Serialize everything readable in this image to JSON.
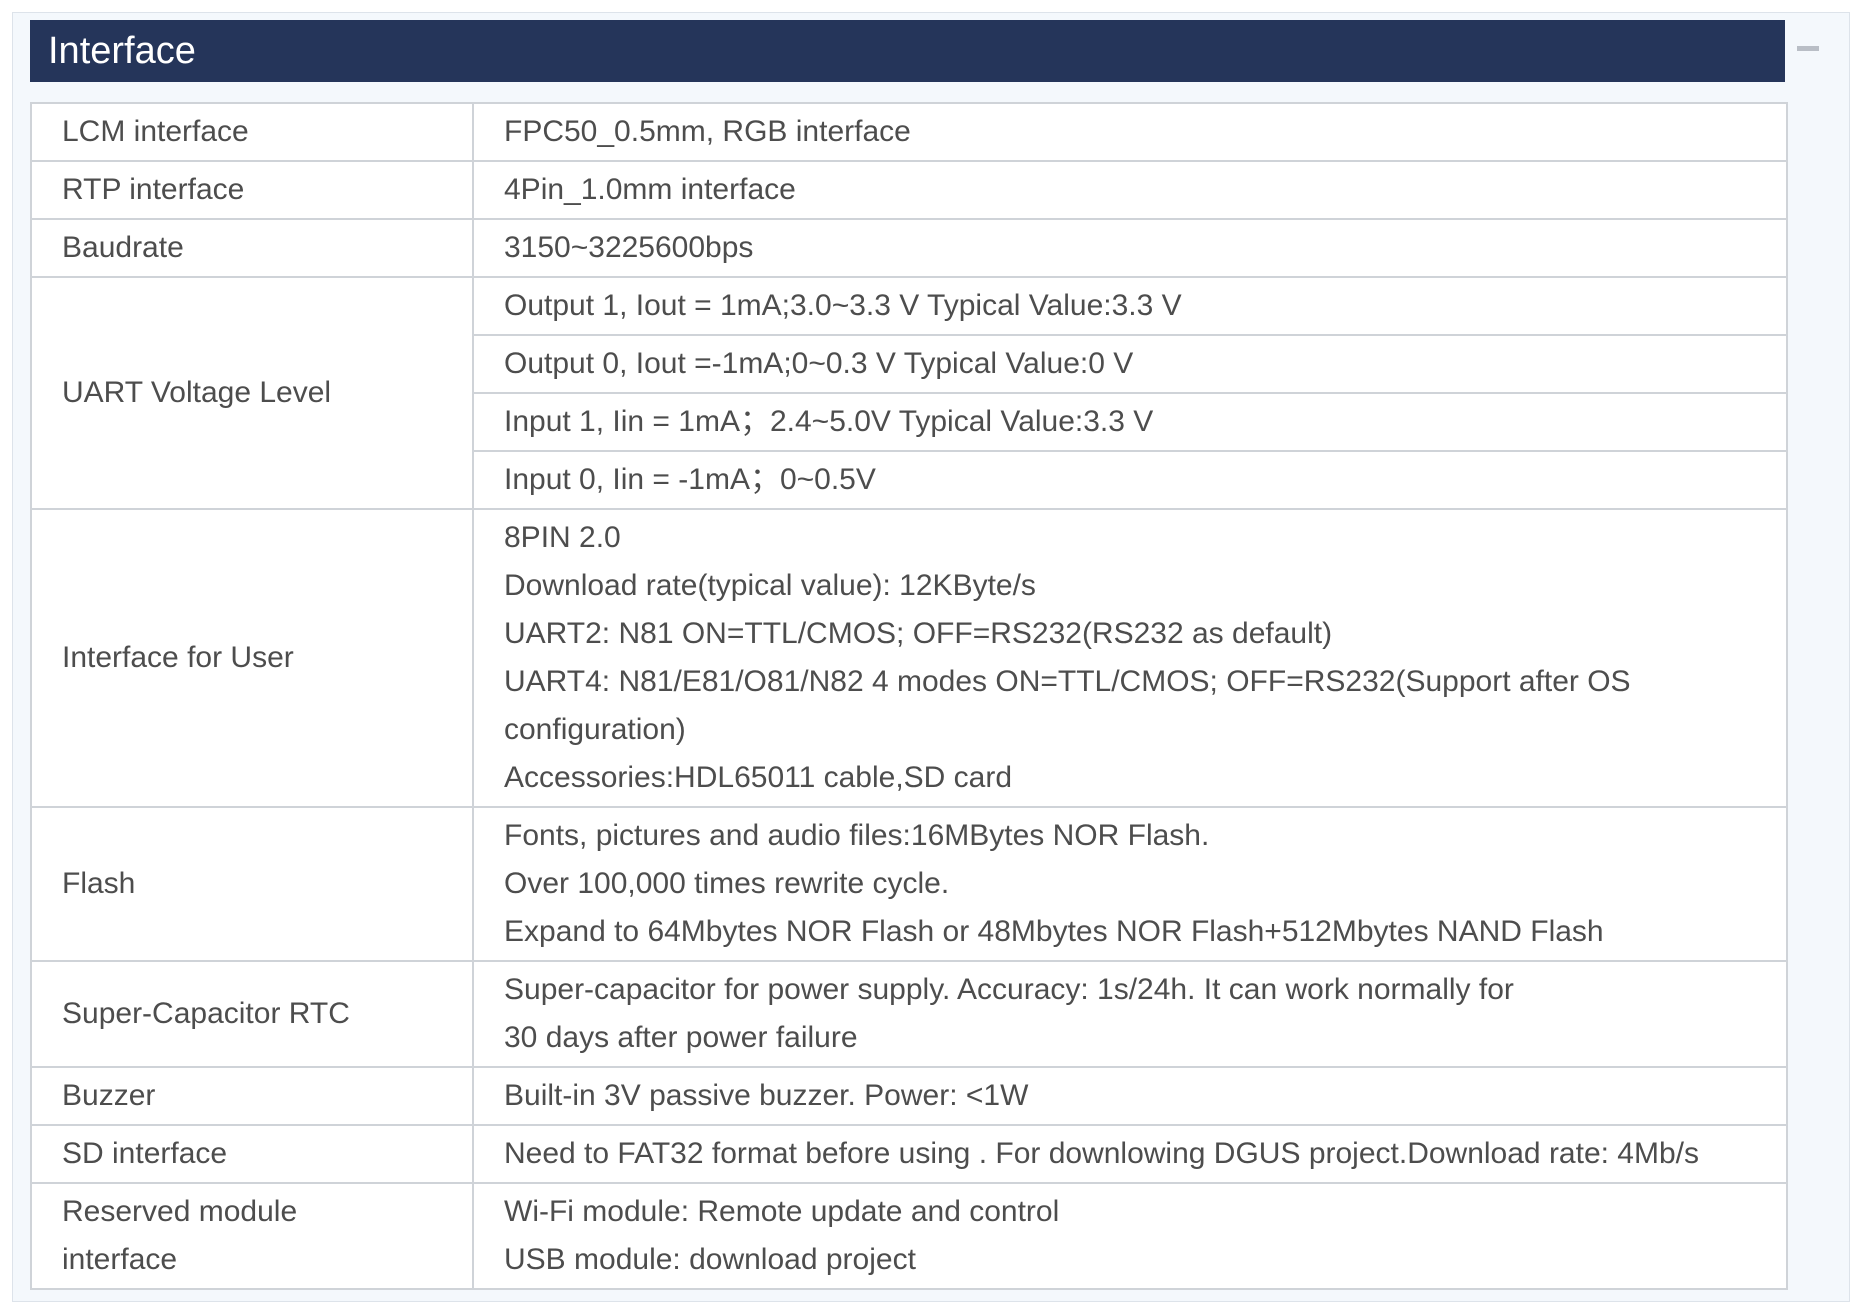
{
  "section": {
    "title": "Interface",
    "collapse_icon": "minus-icon"
  },
  "rows": {
    "lcm": {
      "label": "LCM interface",
      "value": "FPC50_0.5mm, RGB interface"
    },
    "rtp": {
      "label": "RTP interface",
      "value": "4Pin_1.0mm interface"
    },
    "baudrate": {
      "label": "Baudrate",
      "value": "3150~3225600bps"
    },
    "uart_voltage": {
      "label": "UART Voltage Level",
      "lines": [
        "Output 1, Iout = 1mA;3.0~3.3 V Typical Value:3.3 V",
        "Output 0, Iout =-1mA;0~0.3 V   Typical Value:0 V",
        "Input 1,    Iin = 1mA；2.4~5.0V Typical Value:3.3 V",
        "Input 0,    Iin = -1mA；0~0.5V"
      ]
    },
    "user_interface": {
      "label": "Interface for User",
      "lines": [
        "8PIN 2.0",
        "Download rate(typical value): 12KByte/s",
        "UART2: N81  ON=TTL/CMOS; OFF=RS232(RS232 as default)",
        "UART4: N81/E81/O81/N82 4 modes ON=TTL/CMOS; OFF=RS232(Support after OS configuration)",
        "Accessories:HDL65011 cable,SD card"
      ]
    },
    "flash": {
      "label": "Flash",
      "lines": [
        "Fonts, pictures and audio files:16MBytes NOR Flash.",
        "Over 100,000 times rewrite cycle.",
        "Expand to 64Mbytes NOR Flash or 48Mbytes NOR Flash+512Mbytes NAND Flash"
      ]
    },
    "rtc": {
      "label": "Super-Capacitor RTC",
      "lines": [
        "Super-capacitor for power supply. Accuracy: 1s/24h. It can work normally for 30 days after power failure"
      ]
    },
    "buzzer": {
      "label": "Buzzer",
      "value": "Built-in 3V passive buzzer. Power: <1W"
    },
    "sd": {
      "label": "SD interface",
      "value": "Need to FAT32 format before using .  For downlowing DGUS project.Download rate: 4Mb/s"
    },
    "reserved": {
      "label": "Reserved module interface",
      "lines": [
        "Wi-Fi module: Remote update and control",
        "USB module: download project"
      ]
    }
  },
  "colors": {
    "title_bg": "#25355a",
    "panel_bg": "#f4f8fc",
    "border": "#cfd3d8",
    "text": "#4d4d4d"
  }
}
